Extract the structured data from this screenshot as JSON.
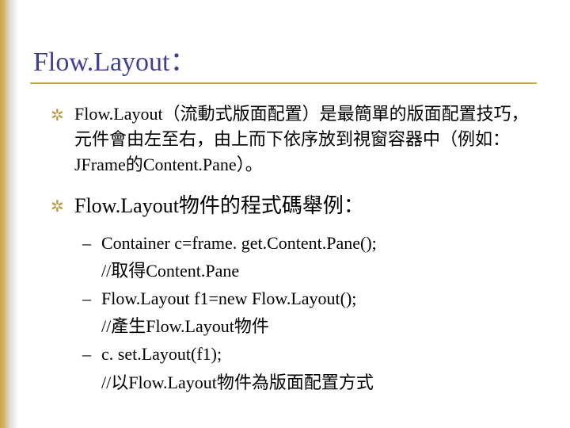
{
  "title": "Flow.Layout：",
  "item1": "Flow.Layout（流動式版面配置）是最簡單的版面配置技巧，元件會由左至右，由上而下依序放到視窗容器中（例如：JFrame的Content.Pane）。",
  "item2": "Flow.Layout物件的程式碼舉例：",
  "sub": {
    "a_code": "Container c=frame. get.Content.Pane();",
    "a_comment": "//取得Content.Pane",
    "b_code": "Flow.Layout f1=new Flow.Layout();",
    "b_comment": "//產生Flow.Layout物件",
    "c_code": "c. set.Layout(f1);",
    "c_comment": "//以Flow.Layout物件為版面配置方式"
  },
  "bullet_glyph": "✲",
  "dash_glyph": "–"
}
